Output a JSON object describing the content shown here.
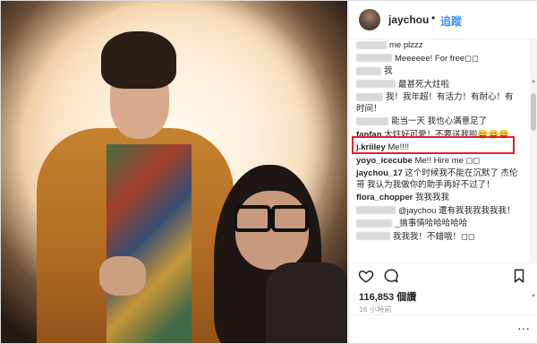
{
  "post": {
    "username": "jaychou",
    "separator": "•",
    "follow_label": "追蹤",
    "likes_count": "116,853",
    "likes_suffix": "個讚",
    "timestamp": "16 小時前",
    "add_comment_placeholder": "",
    "more_label": "···"
  },
  "comments": [
    {
      "user": "",
      "text": "me plzzz"
    },
    {
      "user": "",
      "text": "Meeeeee! For free◻︎◻︎"
    },
    {
      "user": "",
      "text": "我"
    },
    {
      "user": "",
      "text": "最甚死大炷啦"
    },
    {
      "user": "",
      "text": "我！我年超！有活力！有耐心！有时间！"
    },
    {
      "user": "",
      "text": "能当一天 我也心满意足了"
    },
    {
      "user": "fanfan",
      "text": "大炷好可愛！不要送我啦😄😄😄"
    },
    {
      "user": "j.kriiley",
      "text": "Me!!!!"
    },
    {
      "user": "yoyo_icecube",
      "text": "Me!! Hire me ◻︎◻︎"
    },
    {
      "user": "jaychou_17",
      "text": "这个时候我不能在沉默了 杰伦哥 我认为我做你的助手再好不过了！"
    },
    {
      "user": "flora_chopper",
      "text": "我我我我"
    },
    {
      "user": "",
      "text": "@jaychou 還有我我我我我我！"
    },
    {
      "user": "",
      "text": "_搞事情哈哈哈哈哈"
    },
    {
      "user": "",
      "text": "我我我！不錯哦！◻︎◻︎"
    }
  ],
  "colors": {
    "accent": "#3897f0",
    "highlight": "#e3202b",
    "text": "#262626",
    "muted": "#999999"
  },
  "icons": {
    "like": "heart-icon",
    "comment": "speech-bubble-icon",
    "save": "bookmark-icon",
    "more": "ellipsis-icon"
  }
}
